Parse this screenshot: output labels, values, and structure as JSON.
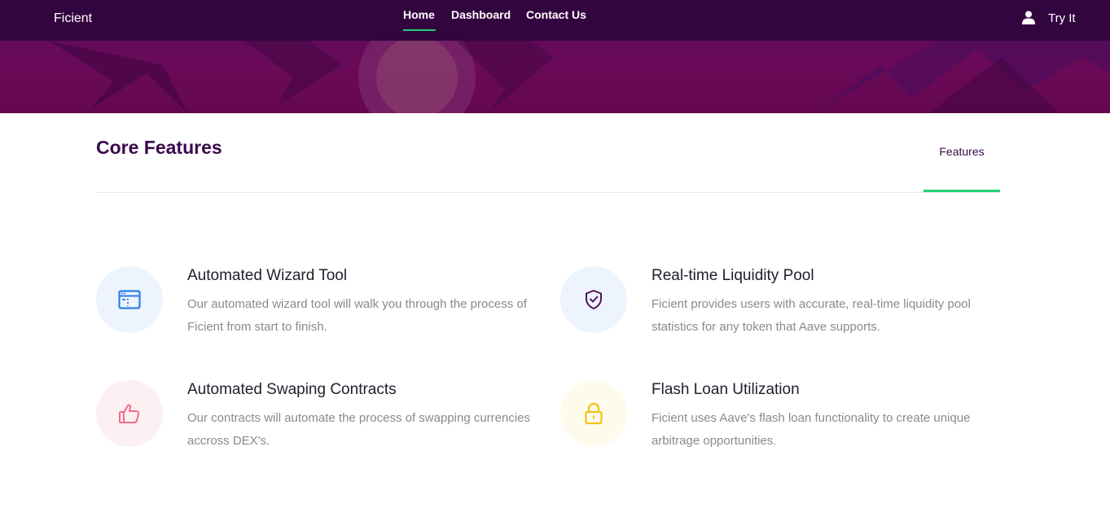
{
  "navbar": {
    "brand": "Ficient",
    "links": [
      {
        "label": "Home"
      },
      {
        "label": "Dashboard"
      },
      {
        "label": "Contact Us"
      }
    ],
    "try_it_label": "Try It"
  },
  "section": {
    "title": "Core Features",
    "tab_label": "Features"
  },
  "features": [
    {
      "title": "Automated Wizard Tool",
      "description": "Our automated wizard tool will walk you through the process of Ficient from start to finish.",
      "icon": "browser-window-icon",
      "icon_color": "#2b7de9",
      "circle_color": "#eef4fd"
    },
    {
      "title": "Real-time Liquidity Pool",
      "description": "Ficient provides users with accurate, real-time liquidity pool statistics for any token that Aave supports.",
      "icon": "shield-check-icon",
      "icon_color": "#4a1456",
      "circle_color": "#eef4fd"
    },
    {
      "title": "Automated Swaping Contracts",
      "description": "Our contracts will automate the process of swapping currencies accross DEX's.",
      "icon": "thumbs-up-icon",
      "icon_color": "#f06a8a",
      "circle_color": "#fdf0f3"
    },
    {
      "title": "Flash Loan Utilization",
      "description": "Ficient uses Aave's flash loan functionality to create unique arbitrage opportunities.",
      "icon": "lock-icon",
      "icon_color": "#f3c218",
      "circle_color": "#fefbec"
    }
  ],
  "colors": {
    "navbar_bg": "#33053f",
    "accent": "#22d07a",
    "heading": "#3a0a4a"
  }
}
